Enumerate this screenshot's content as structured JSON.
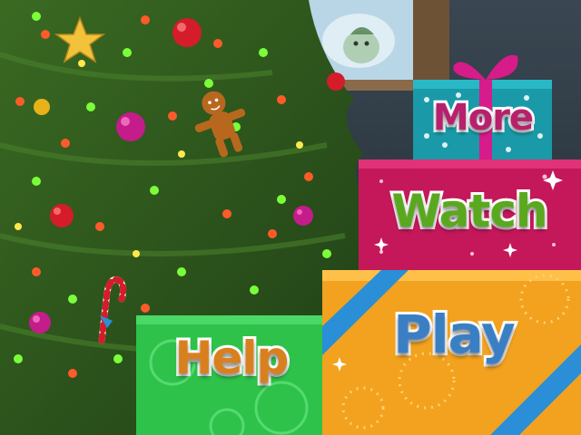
{
  "menu": {
    "more": {
      "label": "More",
      "color": "#b8206e"
    },
    "watch": {
      "label": "Watch",
      "color": "#5aa81e"
    },
    "play": {
      "label": "Play",
      "color": "#3a7fc4"
    },
    "help": {
      "label": "Help",
      "color": "#d9801e"
    }
  },
  "colors": {
    "wall": "#2c3a44",
    "tree": "#2f5a1f",
    "gift_more": "#1a9aa8",
    "gift_watch": "#c4185a",
    "gift_play": "#f2a21e",
    "gift_help": "#2ec24a",
    "ribbon_blue": "#2a8fd6",
    "ribbon_pink": "#d61c8a"
  }
}
